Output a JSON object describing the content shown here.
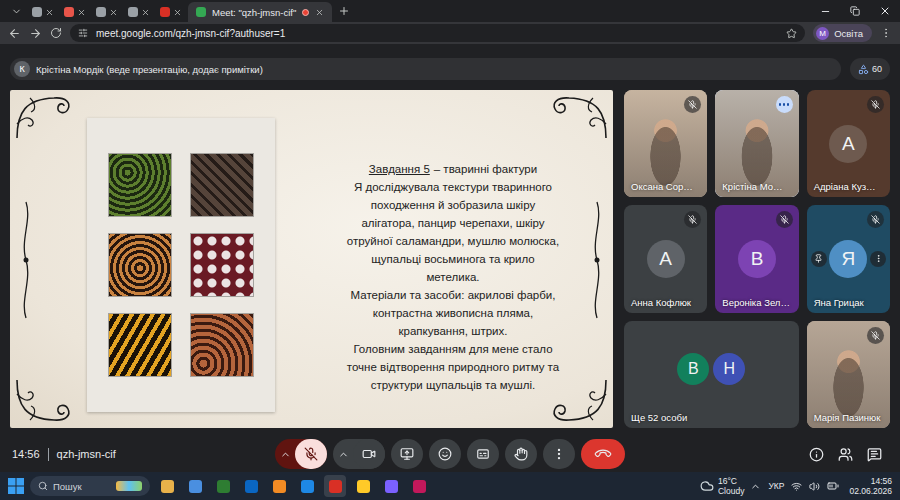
{
  "browser": {
    "tabs": [
      {
        "title": "",
        "selected": false,
        "recording": false,
        "color": "#9aa0a6"
      },
      {
        "title": "",
        "selected": false,
        "recording": false,
        "color": "#e8554a"
      },
      {
        "title": "",
        "selected": false,
        "recording": false,
        "color": "#9aa0a6"
      },
      {
        "title": "",
        "selected": false,
        "recording": false,
        "color": "#9aa0a6"
      },
      {
        "title": "",
        "selected": false,
        "recording": false,
        "color": "#d93025"
      },
      {
        "title": "Meet: \"qzh-jmsn-cif\"",
        "selected": true,
        "recording": true,
        "color": "#34a853"
      }
    ],
    "url": "meet.google.com/qzh-jmsn-cif?authuser=1",
    "profile": {
      "initial": "M",
      "label": "Освіта"
    }
  },
  "meet": {
    "presenter": {
      "initial": "К",
      "label": "Крістіна Мордік (веде презентацію, додає примітки)"
    },
    "participant_count": "60",
    "slide": {
      "heading": {
        "underlined": "Завдання 5",
        "rest": "– тваринні фактури"
      },
      "paragraphs": [
        [
          "Я досліджувала текстури тваринного",
          "походження й зобразила шкіру",
          "алігатора, панцир черепахи, шкіру",
          "отруйної саламандри, мушлю молюска,",
          "щупальці восьминога та крило",
          "метелика."
        ],
        [
          "Матеріали та засоби: акрилові фарби,",
          "контрастна живописна пляма,",
          "крапкування, штрих."
        ],
        [
          "Головним завданням для мене стало",
          "точне відтворення природного ритму та",
          "структури щупальців та мушлі."
        ]
      ]
    },
    "participants": [
      {
        "kind": "video",
        "name": "Оксана Сор…",
        "color": "#c6b4a0",
        "muted": true,
        "speaking": false,
        "hovered": false
      },
      {
        "kind": "video",
        "name": "Крістіна Мо…",
        "color": "#b8b1a9",
        "muted": false,
        "speaking": true,
        "hovered": false
      },
      {
        "kind": "avatar",
        "name": "Адріана Куз…",
        "initial": "А",
        "color": "#553a2d",
        "avatarColor": "#6e5a4f",
        "muted": true,
        "speaking": false,
        "hovered": false
      },
      {
        "kind": "avatar",
        "name": "Анна Кофлюк",
        "initial": "А",
        "color": "#3c4043",
        "avatarColor": "#5f6368",
        "muted": true,
        "speaking": false,
        "hovered": false
      },
      {
        "kind": "avatar",
        "name": "Вероніка Зел…",
        "initial": "В",
        "color": "#5a2a86",
        "avatarColor": "#7d43b3",
        "muted": true,
        "speaking": false,
        "hovered": false
      },
      {
        "kind": "avatar",
        "name": "Яна Грицак",
        "initial": "Я",
        "color": "#1f4b63",
        "avatarColor": "#4f8fc4",
        "muted": true,
        "speaking": false,
        "hovered": true
      },
      {
        "kind": "others",
        "name": "Ще 52 особи",
        "avatars": [
          {
            "initial": "В",
            "color": "#12805c"
          },
          {
            "initial": "Н",
            "color": "#3f51b5"
          }
        ]
      },
      {
        "kind": "video",
        "name": "Марія Пазинюк",
        "color": "#b6a696",
        "muted": true,
        "speaking": false,
        "hovered": false
      }
    ],
    "bottom": {
      "time": "14:56",
      "code": "qzh-jmsn-cif",
      "controls": [
        {
          "kind": "mic",
          "on": false,
          "chevron": true
        },
        {
          "kind": "camera",
          "on": true,
          "chevron": true
        },
        {
          "kind": "present",
          "on": false,
          "chevron": false
        },
        {
          "kind": "emoji",
          "on": false,
          "chevron": false
        },
        {
          "kind": "captions",
          "on": false,
          "chevron": false
        },
        {
          "kind": "hand",
          "on": false,
          "chevron": false
        },
        {
          "kind": "more",
          "on": false,
          "chevron": false
        },
        {
          "kind": "leave",
          "on": false,
          "chevron": false
        }
      ],
      "side": [
        {
          "kind": "info"
        },
        {
          "kind": "people"
        },
        {
          "kind": "chat"
        }
      ]
    }
  },
  "taskbar": {
    "search": "Пошук",
    "temperature": "16°C",
    "condition": "Cloudy",
    "language": "УКР",
    "time": "14:56",
    "date": "02.06.2026"
  }
}
